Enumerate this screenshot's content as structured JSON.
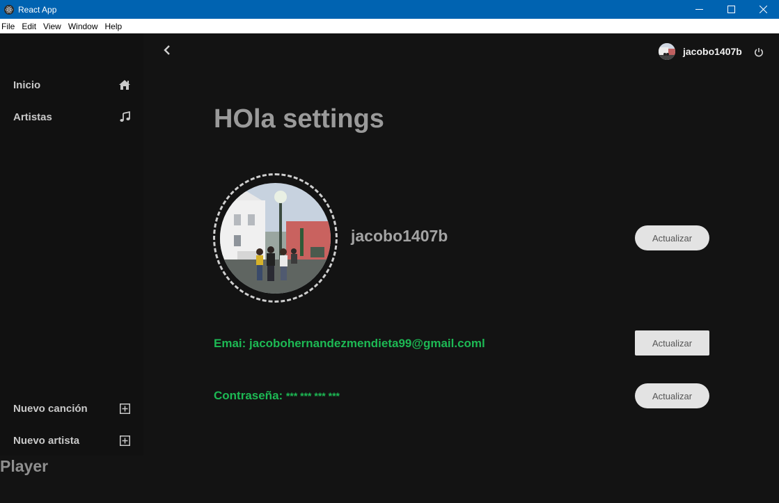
{
  "window": {
    "title": "React App",
    "controls": {
      "minimize": "—",
      "maximize": "☐",
      "close": "✕"
    }
  },
  "menu": [
    "File",
    "Edit",
    "View",
    "Window",
    "Help"
  ],
  "sidebar": {
    "top_items": [
      {
        "label": "Inicio",
        "icon": "home-icon"
      },
      {
        "label": "Artistas",
        "icon": "music-note-icon"
      }
    ],
    "bottom_items": [
      {
        "label": "Nuevo canción",
        "icon": "plus-square-icon"
      },
      {
        "label": "Nuevo artista",
        "icon": "plus-square-icon"
      }
    ]
  },
  "player": {
    "label": "Player"
  },
  "header": {
    "username": "jacobo1407b",
    "back_icon": "chevron-left-icon",
    "power_icon": "power-icon"
  },
  "settings": {
    "title": "HOla settings",
    "profile_name": "jacobo1407b",
    "update_label": "Actualizar",
    "email_label": "Emai:",
    "email_value": "jacobohernandezmendieta99@gmail.coml",
    "password_label": "Contraseña:",
    "password_value": "*** *** *** ***"
  },
  "colors": {
    "accent": "#1db954",
    "titlebar": "#0063b1",
    "background": "#131313",
    "sidebar": "#111111"
  }
}
